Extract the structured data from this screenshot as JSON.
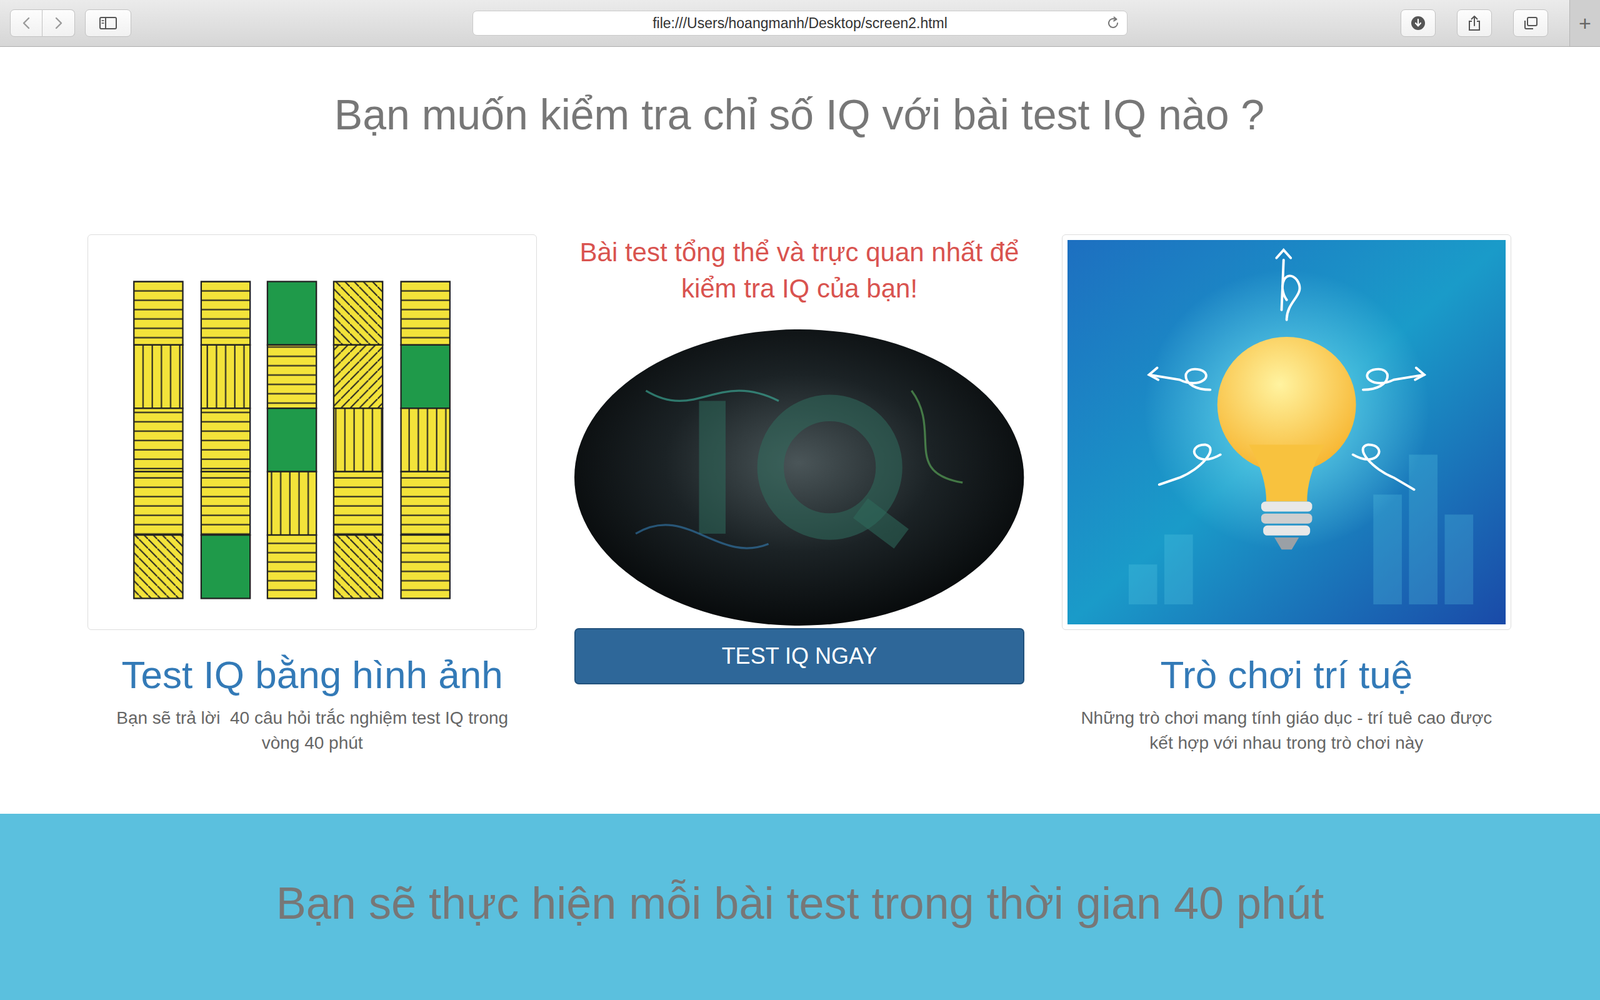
{
  "browser": {
    "url": "file:///Users/hoangmanh/Desktop/screen2.html",
    "new_tab": "+"
  },
  "heading": "Bạn muốn kiểm tra chỉ số IQ với bài test IQ nào ?",
  "cards": [
    {
      "kind": "puzzle",
      "title": "Test IQ bằng hình ảnh",
      "description": "Bạn sẽ trả lời  40 câu hỏi trắc nghiệm test IQ trong vòng 40 phút"
    },
    {
      "kind": "featured",
      "tagline": "Bài test tổng thể và trực quan nhất để kiểm tra IQ của bạn!",
      "button": "TEST IQ NGAY"
    },
    {
      "kind": "bulb",
      "title": "Trò chơi trí tuệ",
      "description": "Những trò chơi mang tính giáo dục - trí tuê cao được kết hợp với nhau trong trò chơi này"
    }
  ],
  "banner": "Bạn sẽ thực hiện mỗi bài test trong thời gian 40 phút"
}
